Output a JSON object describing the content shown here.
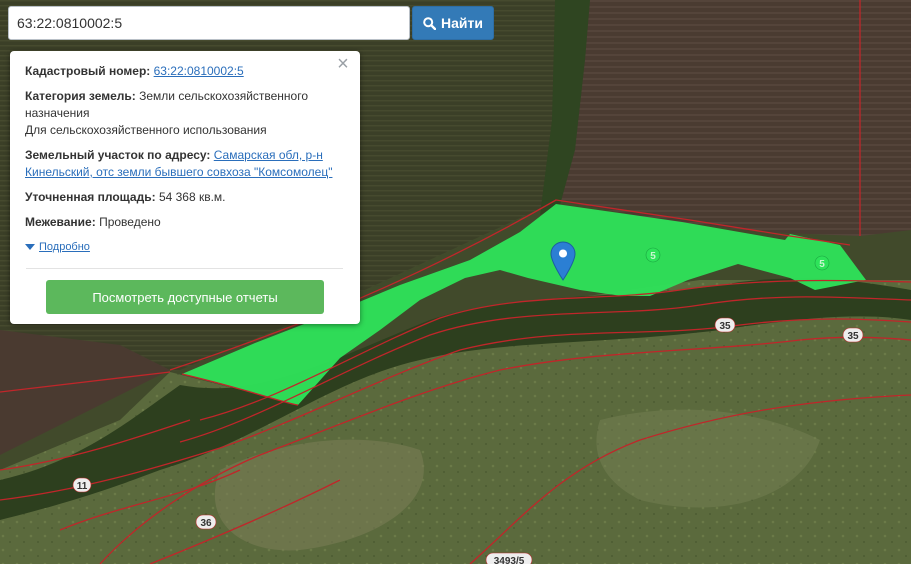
{
  "search": {
    "value": "63:22:0810002:5",
    "button_label": "Найти"
  },
  "popup": {
    "cadastral_label": "Кадастровый номер:",
    "cadastral_number": "63:22:0810002:5",
    "category_label": "Категория земель:",
    "category_value": "Земли сельскохозяйственного назначения",
    "permitted_use": "Для сельскохозяйственного использования",
    "address_label": "Земельный участок по адресу:",
    "address_value": "Самарская обл, р-н Кинельский, отс земли бывшего совхоза \"Комсомолец\"",
    "area_label": "Уточненная площадь:",
    "area_value": "54 368 кв.м.",
    "survey_label": "Межевание:",
    "survey_value": "Проведено",
    "more_link": "Подробно",
    "reports_button": "Посмотреть доступные отчеты",
    "close_glyph": "×"
  },
  "map_labels": {
    "parcel_5_a": "5",
    "parcel_5_b": "5",
    "parcel_35_a": "35",
    "parcel_35_b": "35",
    "parcel_11": "11",
    "parcel_36": "36",
    "parcel_3493": "3493/5"
  },
  "colors": {
    "parcel_fill": "#2ee35a",
    "boundary": "#c0262a",
    "marker": "#2b7fd4",
    "search_button": "#337ab7",
    "reports_button": "#5cb85c",
    "link": "#2a6ebb"
  },
  "icons": {
    "search_button_icon": "search-icon",
    "popup_close": "close-icon",
    "more_toggle": "caret-down-icon",
    "map_marker": "map-pin-icon"
  }
}
